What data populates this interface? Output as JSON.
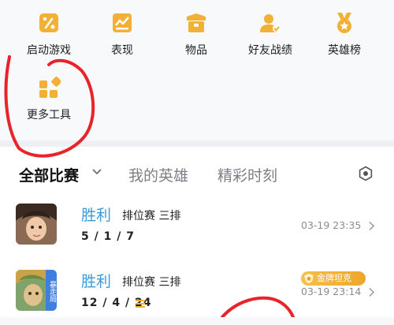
{
  "toolbar": {
    "items": [
      {
        "label": "启动游戏",
        "icon": "gamepad-icon"
      },
      {
        "label": "表现",
        "icon": "chart-icon"
      },
      {
        "label": "物品",
        "icon": "box-icon"
      },
      {
        "label": "好友战绩",
        "icon": "friend-icon"
      },
      {
        "label": "英雄榜",
        "icon": "medal-icon"
      },
      {
        "label": "更多工具",
        "icon": "grid-icon"
      }
    ]
  },
  "tabs": {
    "items": [
      {
        "label": "全部比赛",
        "active": true
      },
      {
        "label": "我的英雄",
        "active": false
      },
      {
        "label": "精彩时刻",
        "active": false
      }
    ]
  },
  "matches": [
    {
      "result": "胜利",
      "mode": "排位赛 三排",
      "kda": "5 / 1 / 7",
      "time": "03-19 23:35",
      "tag": "",
      "badge": ""
    },
    {
      "result": "胜利",
      "mode": "排位赛 三排",
      "kda": "12 / 4 / 24",
      "time": "03-19 23:14",
      "tag": "暴走局",
      "badge": "金牌坦克"
    }
  ],
  "colors": {
    "accent": "#f2b135",
    "result_blue": "#3a9ad9",
    "annotation_red": "#e8232a"
  }
}
